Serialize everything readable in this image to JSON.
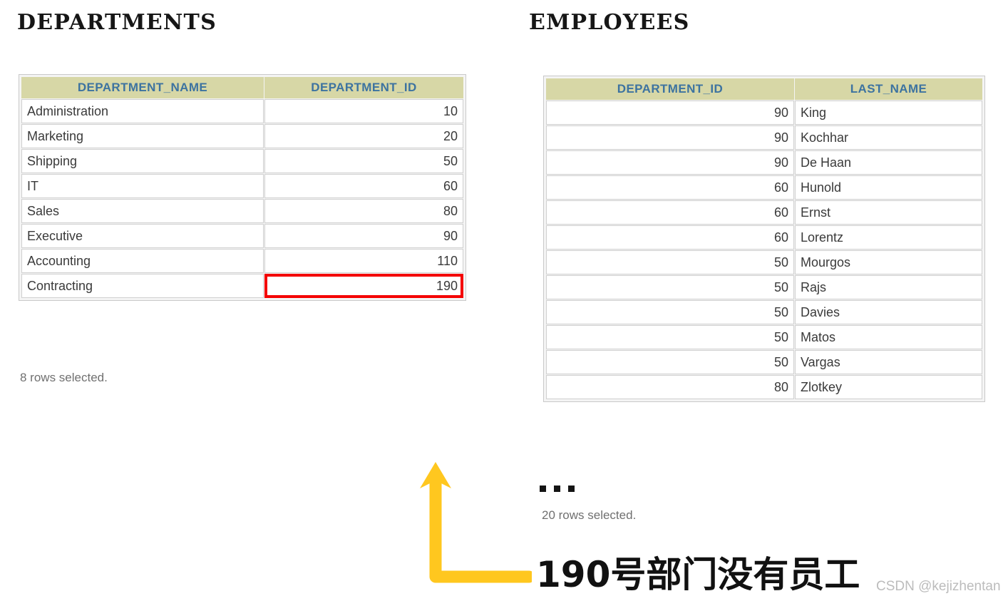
{
  "departments": {
    "title": "DEPARTMENTS",
    "columns": [
      "DEPARTMENT_NAME",
      "DEPARTMENT_ID"
    ],
    "rows": [
      {
        "name": "Administration",
        "id": "10",
        "highlight": false
      },
      {
        "name": "Marketing",
        "id": "20",
        "highlight": false
      },
      {
        "name": "Shipping",
        "id": "50",
        "highlight": false
      },
      {
        "name": "IT",
        "id": "60",
        "highlight": false
      },
      {
        "name": "Sales",
        "id": "80",
        "highlight": false
      },
      {
        "name": "Executive",
        "id": "90",
        "highlight": false
      },
      {
        "name": "Accounting",
        "id": "110",
        "highlight": false
      },
      {
        "name": "Contracting",
        "id": "190",
        "highlight": true
      }
    ],
    "rows_caption": "8 rows selected."
  },
  "employees": {
    "title": "EMPLOYEES",
    "columns": [
      "DEPARTMENT_ID",
      "LAST_NAME"
    ],
    "rows": [
      {
        "id": "90",
        "name": "King"
      },
      {
        "id": "90",
        "name": "Kochhar"
      },
      {
        "id": "90",
        "name": "De Haan"
      },
      {
        "id": "60",
        "name": "Hunold"
      },
      {
        "id": "60",
        "name": "Ernst"
      },
      {
        "id": "60",
        "name": "Lorentz"
      },
      {
        "id": "50",
        "name": "Mourgos"
      },
      {
        "id": "50",
        "name": "Rajs"
      },
      {
        "id": "50",
        "name": "Davies"
      },
      {
        "id": "50",
        "name": "Matos"
      },
      {
        "id": "50",
        "name": "Vargas"
      },
      {
        "id": "80",
        "name": "Zlotkey"
      }
    ],
    "ellipsis": "...",
    "rows_caption": "20 rows selected."
  },
  "callout": {
    "text": "190号部门没有员工",
    "arrow_icon": "elbow-arrow-up-icon",
    "arrow_color": "#FFC71F"
  },
  "watermark": "CSDN @kejizhentan",
  "colors": {
    "header_background": "#d7d7a6",
    "header_text": "#3d73a0",
    "highlight_border": "#f40000",
    "arrow": "#FFC71F",
    "cell_text": "#3a3a3a"
  }
}
